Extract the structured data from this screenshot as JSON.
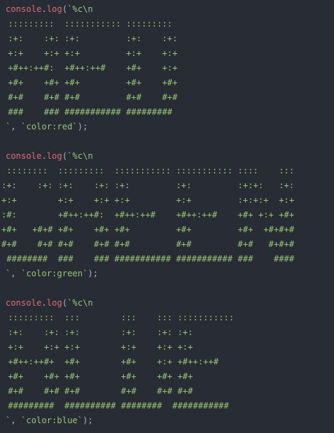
{
  "colors": {
    "background": "#282c34",
    "object": "#e06c75",
    "punctuation": "#abb2bf",
    "string": "#98c379"
  },
  "blocks": [
    {
      "call": {
        "obj": "console",
        "dot": ".",
        "method": "log",
        "open": "(",
        "start": "`%c\\n"
      },
      "art": [
        " :::::::::  ::::::::::: :::::::::",
        " :+:    :+: :+:         :+:    :+:",
        " +:+    +:+ +:+         +:+    +:+",
        " +#++:++#:  +#++:++#    +#+    +:+",
        " +#+    +#+ +#+         +#+    +#+",
        " #+#    #+# #+#         #+#    #+#",
        " ###    ### ########### #########"
      ],
      "end": {
        "tick": "`",
        "comma": ", ",
        "arg": "`color:red`",
        "close": ");"
      }
    },
    {
      "call": {
        "obj": "console",
        "dot": ".",
        "method": "log",
        "open": "(",
        "start": "`%c\\n"
      },
      "art": [
        " ::::::::  :::::::::  ::::::::::: ::::::::::: ::::    :::",
        ":+:    :+: :+:    :+: :+:         :+:         :+:+:   :+:",
        "+:+        +:+    +:+ +:+         +:+         :+:+:+  +:+",
        ":#:        +#++:++#:  +#++:++#    +#++:++#    +#+ +:+ +#+",
        "+#+   +#+# +#+    +#+ +#+         +#+         +#+  +#+#+#",
        "#+#    #+# #+#    #+# #+#         #+#         #+#   #+#+#",
        " ########  ###    ### ########### ########### ###    ####"
      ],
      "end": {
        "tick": "`",
        "comma": ", ",
        "arg": "`color:green`",
        "close": ");"
      }
    },
    {
      "call": {
        "obj": "console",
        "dot": ".",
        "method": "log",
        "open": "(",
        "start": "`%c\\n"
      },
      "art": [
        " :::::::::  :::        :::    ::: :::::::::::",
        " :+:    :+: :+:        :+:    :+: :+:",
        " +:+    +:+ +:+        +:+    +:+ +:+",
        " +#++:++#+  +#+        +#+    +:+ +#++:++#",
        " +#+    +#+ +#+        +#+    +#+ +#+",
        " #+#    #+# #+#        #+#    #+# #+#",
        " #########  ########## ########  ###########"
      ],
      "end": {
        "tick": "`",
        "comma": ", ",
        "arg": "`color:blue`",
        "close": ");"
      }
    }
  ]
}
